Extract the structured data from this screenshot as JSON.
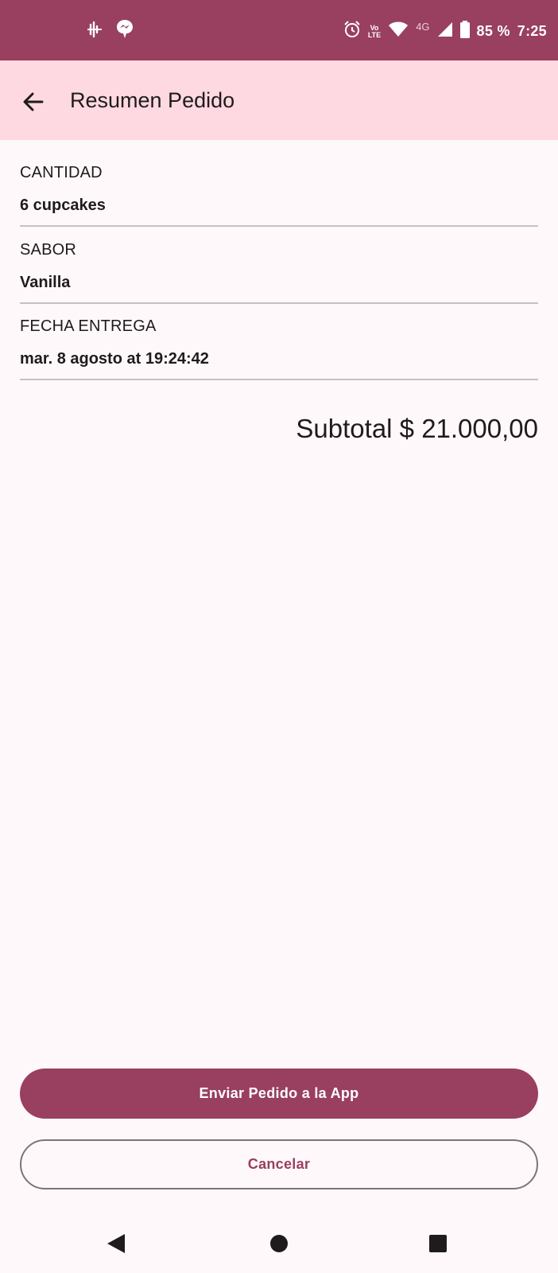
{
  "colors": {
    "primary": "#993f60",
    "app_bar": "#ffd9e1",
    "background": "#fef8fb"
  },
  "status_bar": {
    "left_icons": [
      "audio-wave-icon",
      "messenger-icon"
    ],
    "right_icons": [
      "alarm-icon",
      "volte-icon",
      "wifi-icon",
      "signal-icon",
      "battery-icon"
    ],
    "volte_label_top": "Vo",
    "volte_label_bottom": "LTE",
    "network": "4G",
    "battery": "85 %",
    "time": "7:25"
  },
  "app_bar": {
    "title": "Resumen Pedido"
  },
  "summary": {
    "quantity_label": "CANTIDAD",
    "quantity_value": "6 cupcakes",
    "flavor_label": "SABOR",
    "flavor_value": "Vanilla",
    "date_label": "FECHA ENTREGA",
    "date_value": "mar. 8 agosto at 19:24:42"
  },
  "subtotal": "Subtotal $ 21.000,00",
  "actions": {
    "send_label": "Enviar Pedido a la App",
    "cancel_label": "Cancelar"
  },
  "nav_bar": {
    "icons": [
      "back-triangle-icon",
      "home-circle-icon",
      "recents-square-icon"
    ]
  }
}
